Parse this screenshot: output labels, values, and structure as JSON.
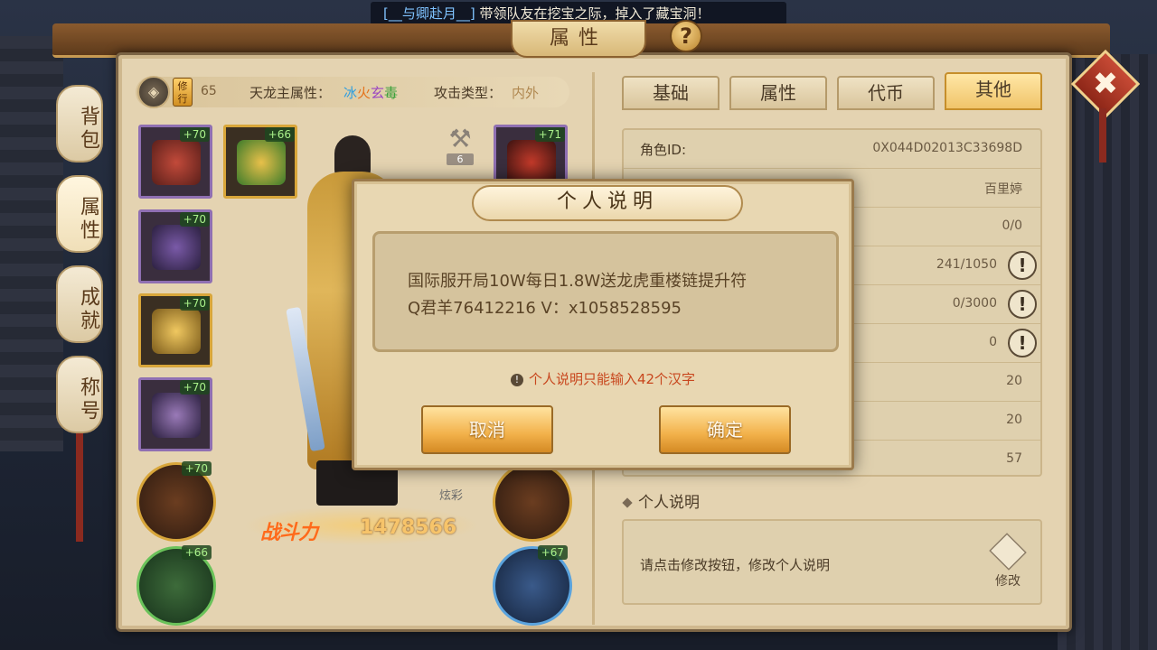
{
  "marquee": {
    "name": "[__与卿赴月__]",
    "text": "带领队友在挖宝之际，掉入了藏宝洞！"
  },
  "window": {
    "title": "属性",
    "help": "?",
    "close": "✖"
  },
  "side_tabs": [
    "背包",
    "属性",
    "成就",
    "称号"
  ],
  "header": {
    "xiu_badge": "修行",
    "level": "65",
    "attr_label": "天龙主属性：",
    "attr_value": {
      "ice": "冰",
      "fire": "火",
      "xuan": "玄",
      "poison": "毒"
    },
    "attack_label": "攻击类型：",
    "attack_value": "内外"
  },
  "equip_slots_left": [
    "+70",
    "+70",
    "+70",
    "+70"
  ],
  "equip_slot_top": "+66",
  "equip_slot_right": "+71",
  "round_slots": {
    "left_top": "+70",
    "left_bottom": "+66",
    "right_bottom": "+67"
  },
  "hammer_count": "6",
  "dazzle_label": "炫彩",
  "power": {
    "label": "战斗力",
    "value": "1478566"
  },
  "tabs": [
    {
      "label": "基础",
      "active": false
    },
    {
      "label": "属性",
      "active": false
    },
    {
      "label": "代币",
      "active": false
    },
    {
      "label": "其他",
      "active": true
    }
  ],
  "info_rows": [
    {
      "label": "角色ID:",
      "value": "0X044D02013C33698D",
      "has_button": false
    },
    {
      "label": "",
      "value": "百里婷",
      "has_button": false
    },
    {
      "label": "",
      "value": "0/0",
      "has_button": false
    },
    {
      "label": "",
      "value": "241/1050",
      "has_button": true
    },
    {
      "label": "",
      "value": "0/3000",
      "has_button": true
    },
    {
      "label": "",
      "value": "0",
      "has_button": true
    },
    {
      "label": "",
      "value": "20",
      "has_button": false
    },
    {
      "label": "",
      "value": "20",
      "has_button": false
    },
    {
      "label": "",
      "value": "57",
      "has_button": false
    }
  ],
  "personal": {
    "section_title": "个人说明",
    "placeholder": "请点击修改按钮，修改个人说明",
    "edit_label": "修改"
  },
  "modal": {
    "title": "个人说明",
    "line1": "国际服开局10W每日1.8W送龙虎重楼链提升符",
    "line2": "Q君羊76412216 V：x1058528595",
    "warning": "个人说明只能输入42个汉字",
    "warn_icon": "!",
    "cancel": "取消",
    "confirm": "确定"
  },
  "colors": {
    "panel": "#e4d3b1",
    "accent_gold": "#f2b14a",
    "warning": "#c8471e",
    "power": "#ff6a1a"
  }
}
